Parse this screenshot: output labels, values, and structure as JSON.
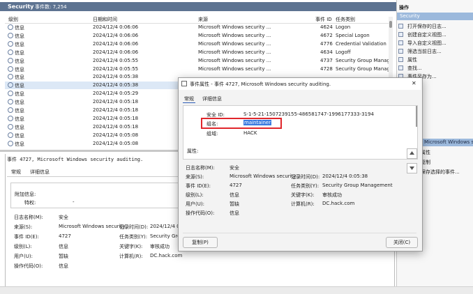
{
  "top": {
    "title": "Security",
    "count_label": "事件数: 7,254"
  },
  "columns": {
    "level": "级别",
    "datetime": "日期和时间",
    "source": "来源",
    "event_id": "事件 ID",
    "category": "任务类别"
  },
  "rows": [
    {
      "level": "信息",
      "datetime": "2024/12/4 0:06:06",
      "source": "Microsoft Windows security ...",
      "event_id": "4624",
      "category": "Logon"
    },
    {
      "level": "信息",
      "datetime": "2024/12/4 0:06:06",
      "source": "Microsoft Windows security ...",
      "event_id": "4672",
      "category": "Special Logon"
    },
    {
      "level": "信息",
      "datetime": "2024/12/4 0:06:06",
      "source": "Microsoft Windows security ...",
      "event_id": "4776",
      "category": "Credential Validation"
    },
    {
      "level": "信息",
      "datetime": "2024/12/4 0:06:06",
      "source": "Microsoft Windows security ...",
      "event_id": "4634",
      "category": "Logoff"
    },
    {
      "level": "信息",
      "datetime": "2024/12/4 0:05:55",
      "source": "Microsoft Windows security ...",
      "event_id": "4737",
      "category": "Security Group Manage"
    },
    {
      "level": "信息",
      "datetime": "2024/12/4 0:05:55",
      "source": "Microsoft Windows security ...",
      "event_id": "4728",
      "category": "Security Group Manage"
    },
    {
      "level": "信息",
      "datetime": "2024/12/4 0:05:38",
      "source": "",
      "event_id": "",
      "category": ""
    },
    {
      "level": "信息",
      "datetime": "2024/12/4 0:05:38",
      "source": "",
      "event_id": "",
      "category": ""
    },
    {
      "level": "信息",
      "datetime": "2024/12/4 0:05:29",
      "source": "",
      "event_id": "",
      "category": ""
    },
    {
      "level": "信息",
      "datetime": "2024/12/4 0:05:18",
      "source": "",
      "event_id": "",
      "category": ""
    },
    {
      "level": "信息",
      "datetime": "2024/12/4 0:05:18",
      "source": "",
      "event_id": "",
      "category": ""
    },
    {
      "level": "信息",
      "datetime": "2024/12/4 0:05:18",
      "source": "",
      "event_id": "",
      "category": ""
    },
    {
      "level": "信息",
      "datetime": "2024/12/4 0:05:18",
      "source": "",
      "event_id": "",
      "category": ""
    },
    {
      "level": "信息",
      "datetime": "2024/12/4 0:05:08",
      "source": "",
      "event_id": "",
      "category": ""
    },
    {
      "level": "信息",
      "datetime": "2024/12/4 0:05:08",
      "source": "",
      "event_id": "",
      "category": ""
    }
  ],
  "detail": {
    "header": "事件 4727, Microsoft Windows security auditing.",
    "tab_general": "常规",
    "tab_details": "详细信息",
    "additional_info": "附加信息:",
    "privileges_label": "特权:",
    "privileges_value": "-",
    "log_name_label": "日志名称(M):",
    "log_name_value": "安全",
    "source_label": "来源(S):",
    "source_value": "Microsoft Windows security",
    "logged_label": "记录时间(D):",
    "logged_value": "2024/12/4 0:05:38",
    "event_id_label": "事件 ID(E):",
    "event_id_value": "4727",
    "category_label": "任务类别(Y):",
    "category_value": "Security Group",
    "level_label": "级别(L):",
    "level_value": "信息",
    "keywords_label": "关键字(K):",
    "keywords_value": "审核成功",
    "user_label": "用户(U):",
    "user_value": "暂缺",
    "computer_label": "计算机(R):",
    "computer_value": "DC.hack.com",
    "opcode_label": "操作代码(O):",
    "opcode_value": "信息"
  },
  "actions": {
    "header": "操作",
    "section": "Security",
    "items": [
      "打开保存的日志...",
      "创建自定义视图...",
      "导入自定义视图...",
      "筛选当前日志...",
      "属性",
      "查找...",
      "事件另存为..."
    ],
    "section2": "Microsoft Windows secu",
    "items2": [
      "属性",
      "复制",
      "保存选择的事件..."
    ]
  },
  "dialog": {
    "title": "事件属性 - 事件 4727, Microsoft Windows security auditing.",
    "close_glyph": "✕",
    "tab_general": "常规",
    "tab_details": "详细信息",
    "security_id_label": "安全 ID:",
    "security_id_value": "S-1-5-21-1507239155-486581747-1996177333-3194",
    "group_name_label": "组名:",
    "group_name_value": "maintainer",
    "group_domain_label": "组域:",
    "group_domain_value": "HACK",
    "attributes_label": "属性:",
    "log_name_label": "日志名称(M):",
    "log_name_value": "安全",
    "source_label": "来源(S):",
    "source_value": "Microsoft Windows security",
    "logged_label": "记录时间(D):",
    "logged_value": "2024/12/4 0:05:38",
    "event_id_label": "事件 ID(E):",
    "event_id_value": "4727",
    "category_label": "任务类别(Y):",
    "category_value": "Security Group Management",
    "level_label": "级别(L):",
    "level_value": "信息",
    "keywords_label": "关键字(K):",
    "keywords_value": "审核成功",
    "user_label": "用户(U):",
    "user_value": "暂缺",
    "computer_label": "计算机(R):",
    "computer_value": "DC.hack.com",
    "opcode_label": "操作代码(O):",
    "opcode_value": "信息",
    "copy_button": "复制(P)",
    "close_button": "关闭(C)",
    "highlight_color": "#e0262b"
  }
}
